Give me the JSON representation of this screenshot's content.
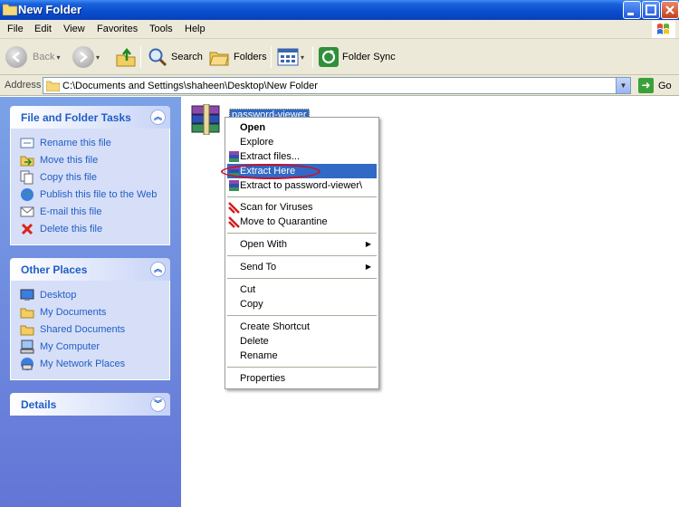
{
  "window": {
    "title": "New Folder",
    "controls": [
      "minimize",
      "maximize",
      "close"
    ]
  },
  "menubar": {
    "items": [
      "File",
      "Edit",
      "View",
      "Favorites",
      "Tools",
      "Help"
    ]
  },
  "toolbar": {
    "back_label": "Back",
    "search_label": "Search",
    "folders_label": "Folders",
    "folder_sync_label": "Folder Sync"
  },
  "addressbar": {
    "label": "Address",
    "path": "C:\\Documents and Settings\\shaheen\\Desktop\\New Folder",
    "go_label": "Go"
  },
  "taskpane": {
    "file_tasks": {
      "title": "File and Folder Tasks",
      "items": [
        {
          "label": "Rename this file",
          "icon": "rename-icon"
        },
        {
          "label": "Move this file",
          "icon": "move-icon"
        },
        {
          "label": "Copy this file",
          "icon": "copy-icon"
        },
        {
          "label": "Publish this file to the Web",
          "icon": "globe-icon"
        },
        {
          "label": "E-mail this file",
          "icon": "email-icon"
        },
        {
          "label": "Delete this file",
          "icon": "delete-icon"
        }
      ]
    },
    "other_places": {
      "title": "Other Places",
      "items": [
        {
          "label": "Desktop",
          "icon": "desktop-icon"
        },
        {
          "label": "My Documents",
          "icon": "folder-icon"
        },
        {
          "label": "Shared Documents",
          "icon": "folder-icon"
        },
        {
          "label": "My Computer",
          "icon": "computer-icon"
        },
        {
          "label": "My Network Places",
          "icon": "network-icon"
        }
      ]
    },
    "details": {
      "title": "Details"
    }
  },
  "content": {
    "file_name": "password-viewer"
  },
  "context_menu": {
    "items": [
      {
        "label": "Open"
      },
      {
        "label": "Explore"
      },
      {
        "label": "Extract files..."
      },
      {
        "label": "Extract Here"
      },
      {
        "label": "Extract to password-viewer\\"
      },
      {
        "label": "Scan for Viruses"
      },
      {
        "label": "Move to Quarantine"
      },
      {
        "label": "Open With"
      },
      {
        "label": "Send To"
      },
      {
        "label": "Cut"
      },
      {
        "label": "Copy"
      },
      {
        "label": "Create Shortcut"
      },
      {
        "label": "Delete"
      },
      {
        "label": "Rename"
      },
      {
        "label": "Properties"
      }
    ],
    "highlighted": "Extract Here"
  },
  "colors": {
    "title_bar": "#0a4fd0",
    "task_pane": "#6f8fdf",
    "highlight": "#316ac5",
    "annotation": "#c8102e"
  }
}
